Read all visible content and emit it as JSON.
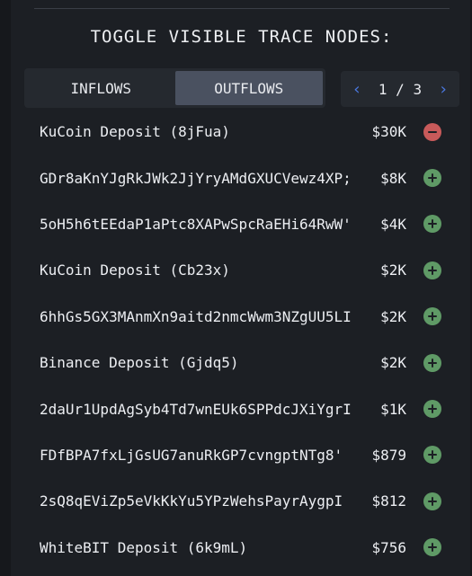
{
  "header": {
    "title": "TOGGLE VISIBLE TRACE NODES:"
  },
  "tabs": [
    {
      "label": "INFLOWS",
      "active": false
    },
    {
      "label": "OUTFLOWS",
      "active": true
    }
  ],
  "pager": {
    "text": "1 / 3",
    "prev_icon": "chevron-left-icon",
    "next_icon": "chevron-right-icon"
  },
  "colors": {
    "accent": "#4a78e0",
    "add": "#5f9a66",
    "remove": "#c85a5a"
  },
  "rows": [
    {
      "name": "KuCoin Deposit (8jFua)",
      "amount": "$30K",
      "action": "remove"
    },
    {
      "name": "GDr8aKnYJgRkJWk2JjYryAMdGXUCVewz4XP;",
      "amount": "$8K",
      "action": "add"
    },
    {
      "name": "5oH5h6tEEdaP1aPtc8XAPwSpcRaEHi64RwW'",
      "amount": "$4K",
      "action": "add"
    },
    {
      "name": "KuCoin Deposit (Cb23x)",
      "amount": "$2K",
      "action": "add"
    },
    {
      "name": "6hhGs5GX3MAnmXn9aitd2nmcWwm3NZgUU5LI",
      "amount": "$2K",
      "action": "add"
    },
    {
      "name": "Binance Deposit (Gjdq5)",
      "amount": "$2K",
      "action": "add"
    },
    {
      "name": "2daUr1UpdAgSyb4Td7wnEUk6SPPdcJXiYgrI",
      "amount": "$1K",
      "action": "add"
    },
    {
      "name": "FDfBPA7fxLjGsUG7anuRkGP7cvngptNTg8'",
      "amount": "$879",
      "action": "add"
    },
    {
      "name": "2sQ8qEViZp5eVkKkYu5YPzWehsPayrAygpI",
      "amount": "$812",
      "action": "add"
    },
    {
      "name": "WhiteBIT Deposit (6k9mL)",
      "amount": "$756",
      "action": "add"
    }
  ]
}
